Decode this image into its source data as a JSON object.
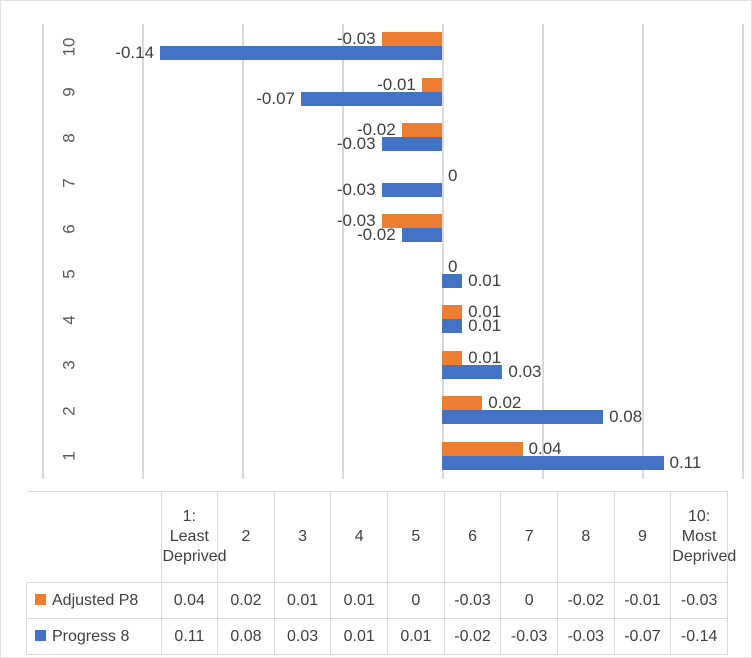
{
  "chart_data": {
    "type": "bar",
    "orientation": "horizontal",
    "title": "",
    "xlabel": "",
    "ylabel": "",
    "grid": true,
    "legend_position": "data-table",
    "xlim": [
      -0.2,
      0.15
    ],
    "gridline_step": 0.05,
    "categories": [
      "1",
      "2",
      "3",
      "4",
      "5",
      "6",
      "7",
      "8",
      "9",
      "10"
    ],
    "category_full_labels": [
      "1: Least Deprived",
      "2",
      "3",
      "4",
      "5",
      "6",
      "7",
      "8",
      "9",
      "10: Most Deprived"
    ],
    "series": [
      {
        "name": "Adjusted P8",
        "color": "#ED7D31",
        "values": [
          0.04,
          0.02,
          0.01,
          0.01,
          0,
          -0.03,
          0,
          -0.02,
          -0.01,
          -0.03
        ],
        "labels": [
          "0.04",
          "0.02",
          "0.01",
          "0.01",
          "0",
          "-0.03",
          "0",
          "-0.02",
          "-0.01",
          "-0.03"
        ]
      },
      {
        "name": "Progress 8",
        "color": "#4472C4",
        "values": [
          0.11,
          0.08,
          0.03,
          0.01,
          0.01,
          -0.02,
          -0.03,
          -0.03,
          -0.07,
          -0.14
        ],
        "labels": [
          "0.11",
          "0.08",
          "0.03",
          "0.01",
          "0.01",
          "-0.02",
          "-0.03",
          "-0.03",
          "-0.07",
          "-0.14"
        ]
      }
    ]
  },
  "data_table": {
    "corner_label": "",
    "column_headers": [
      "1: Least Deprived",
      "2",
      "3",
      "4",
      "5",
      "6",
      "7",
      "8",
      "9",
      "10: Most Deprived"
    ],
    "rows": [
      {
        "label": "Adjusted P8",
        "swatch": "orange-swatch",
        "values": [
          "0.04",
          "0.02",
          "0.01",
          "0.01",
          "0",
          "-0.03",
          "0",
          "-0.02",
          "-0.01",
          "-0.03"
        ]
      },
      {
        "label": "Progress 8",
        "swatch": "blue-swatch",
        "values": [
          "0.11",
          "0.08",
          "0.03",
          "0.01",
          "0.01",
          "-0.02",
          "-0.03",
          "-0.03",
          "-0.07",
          "-0.14"
        ]
      }
    ]
  },
  "colors": {
    "series_orange": "#ED7D31",
    "series_blue": "#4472C4",
    "gridline": "#D9D9D9",
    "text": "#404040",
    "border": "#E2E2E2"
  }
}
